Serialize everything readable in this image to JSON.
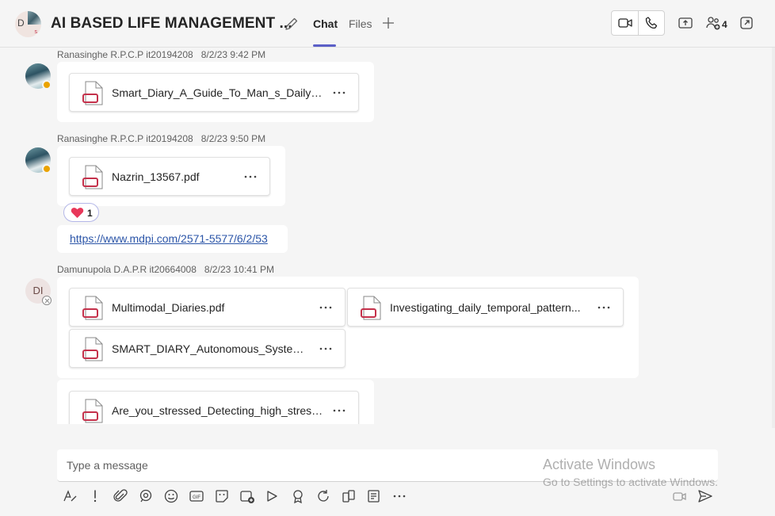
{
  "header": {
    "avatar_initial": "D",
    "avatar_sub": "s",
    "title": "AI BASED LIFE MANAGEMENT ...",
    "tabs": [
      {
        "label": "Chat"
      },
      {
        "label": "Files"
      }
    ],
    "participants_count": "4"
  },
  "messages": [
    {
      "author": "Ranasinghe R.P.C.P it20194208",
      "time": "8/2/23 9:42 PM",
      "files": [
        "Smart_Diary_A_Guide_To_Man_s_Daily_P..."
      ]
    },
    {
      "author": "Ranasinghe R.P.C.P it20194208",
      "time": "8/2/23 9:50 PM",
      "files": [
        "Nazrin_13567.pdf"
      ],
      "reaction_count": "1",
      "link": "https://www.mdpi.com/2571-5577/6/2/53"
    },
    {
      "author": "Damunupola D.A.P.R it20664008",
      "time": "8/2/23 10:41 PM",
      "avatar_initials": "DI",
      "files": [
        "Multimodal_Diaries.pdf",
        "Investigating_daily_temporal_pattern...",
        "SMART_DIARY_Autonomous_System_...",
        "Are_you_stressed_Detecting_high_stress..."
      ]
    }
  ],
  "compose": {
    "placeholder": "Type a message"
  },
  "watermark": {
    "line1": "Activate Windows",
    "line2": "Go to Settings to activate Windows."
  },
  "colors": {
    "accent": "#5b5fc7",
    "file_icon": "#c4314b",
    "link": "#2b55a8",
    "away": "#eaa300"
  }
}
